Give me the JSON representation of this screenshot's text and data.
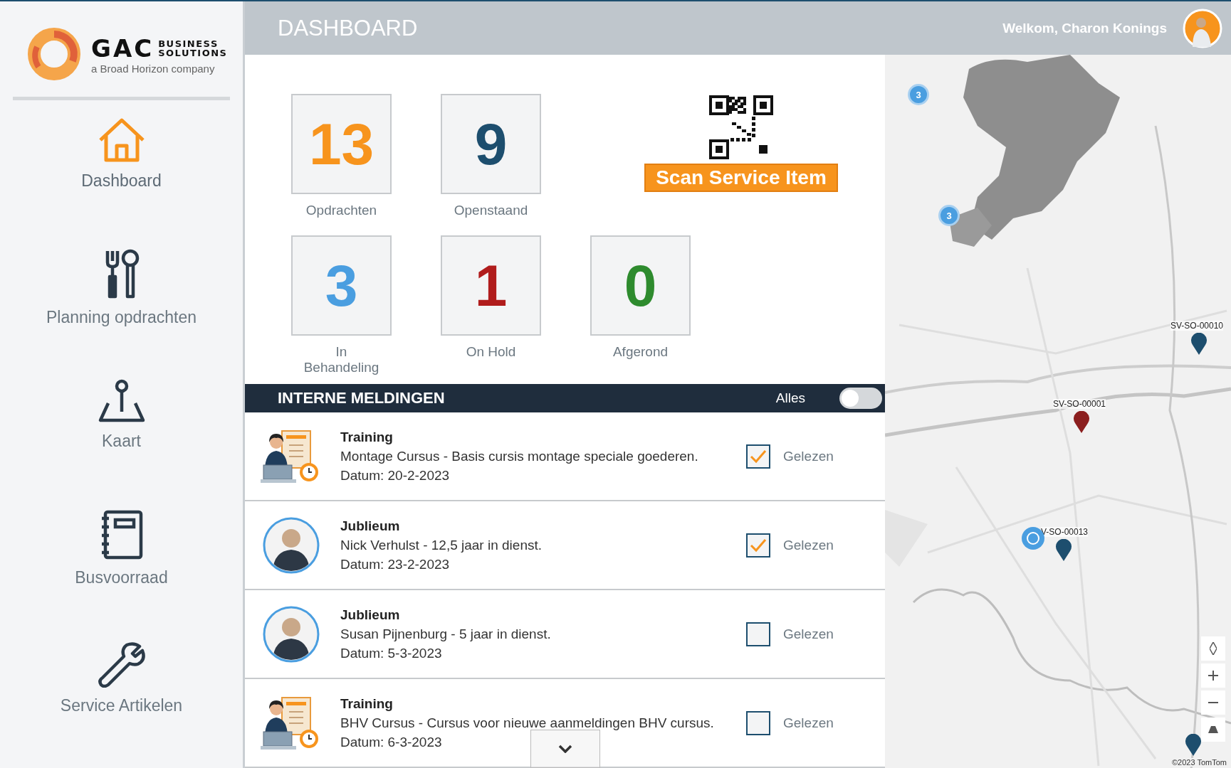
{
  "logo": {
    "brand": "GAC",
    "sub1": "BUSINESS",
    "sub2": "SOLUTIONS",
    "tagline": "a Broad Horizon company"
  },
  "sidebar": {
    "items": [
      {
        "kind": "home",
        "label": "Dashboard",
        "selected": true
      },
      {
        "kind": "tools",
        "label": "Planning opdrachten",
        "selected": false
      },
      {
        "kind": "map",
        "label": "Kaart",
        "selected": false
      },
      {
        "kind": "notebook",
        "label": "Busvoorraad",
        "selected": false
      },
      {
        "kind": "wrench",
        "label": "Service Artikelen",
        "selected": false
      }
    ]
  },
  "header": {
    "title": "DASHBOARD",
    "welcome": "Welkom, Charon Konings"
  },
  "stats": [
    {
      "value": "13",
      "label": "Opdrachten",
      "color": "#f7941d"
    },
    {
      "value": "9",
      "label": "Openstaand",
      "color": "#1d4e6e"
    },
    {
      "value": "3",
      "label": "In Behandeling",
      "color": "#4a9ee0"
    },
    {
      "value": "1",
      "label": "On Hold",
      "color": "#b01c1c"
    },
    {
      "value": "0",
      "label": "Afgerond",
      "color": "#2e8b2e"
    }
  ],
  "scan": {
    "label": "Scan Service Item"
  },
  "notifications": {
    "title": "INTERNE MELDINGEN",
    "filter_label": "Alles",
    "filter_on": false,
    "items": [
      {
        "kind": "training",
        "category": "Training",
        "text": "Montage Cursus - Basis cursis montage speciale goederen.",
        "date": "Datum: 20-2-2023",
        "read": true,
        "read_label": "Gelezen"
      },
      {
        "category": "Jublieum",
        "text": "Nick Verhulst - 12,5 jaar in dienst.",
        "date": "Datum: 23-2-2023",
        "read": true,
        "read_label": "Gelezen"
      },
      {
        "category": "Jublieum",
        "text": "Susan Pijnenburg - 5 jaar in dienst.",
        "date": "Datum: 5-3-2023",
        "read": false,
        "read_label": "Gelezen"
      },
      {
        "kind": "training",
        "category": "Training",
        "text": "BHV Cursus - Cursus voor nieuwe aanmeldingen BHV cursus.",
        "date": "Datum: 6-3-2023",
        "read": false,
        "read_label": "Gelezen"
      }
    ]
  },
  "map": {
    "clusters": [
      {
        "count": "3"
      },
      {
        "count": "3"
      }
    ],
    "pins": [
      {
        "label": "SV-SO-00010",
        "color": "#1d4e6e"
      },
      {
        "label": "SV-SO-00001",
        "color": "#8b1e1e"
      },
      {
        "label": "V-SO-00013",
        "color": "#1d4e6e"
      }
    ],
    "copyright": "©2023 TomTom"
  }
}
